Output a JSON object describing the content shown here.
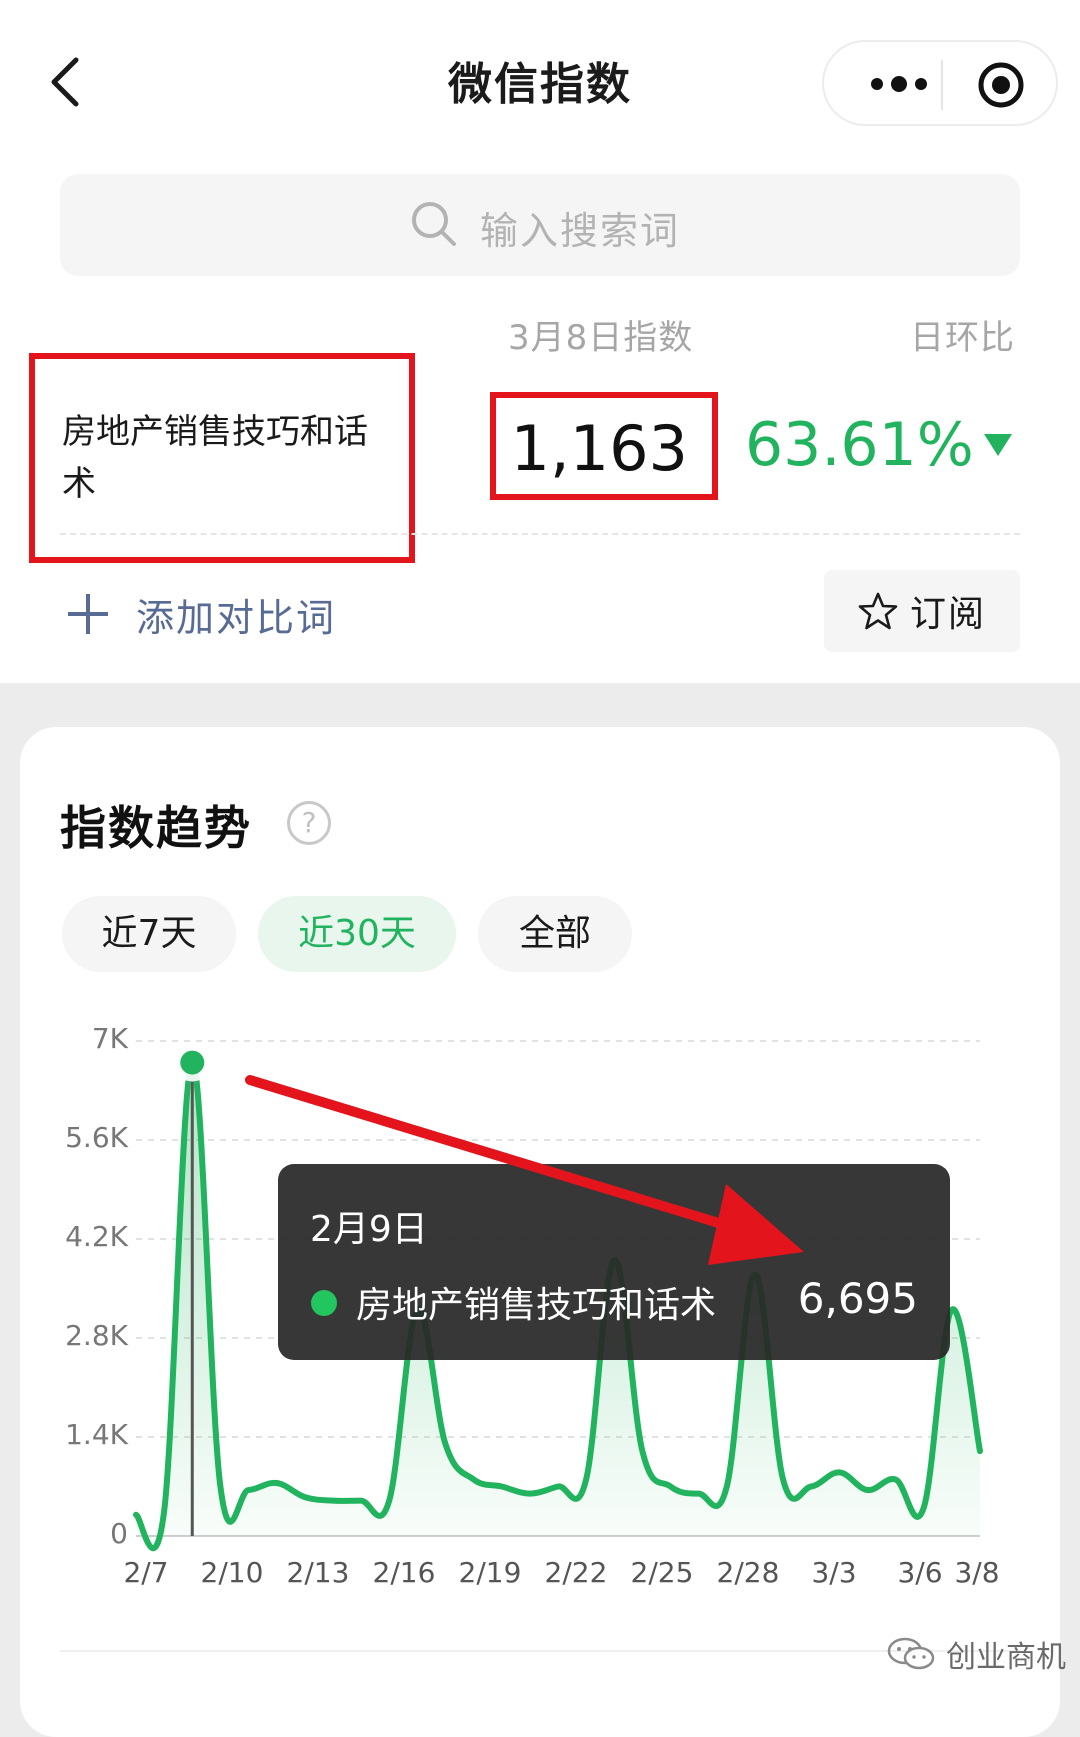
{
  "nav": {
    "title": "微信指数",
    "icons": [
      "back-chevron-icon",
      "more-dots-icon",
      "target-circle-icon"
    ]
  },
  "search": {
    "placeholder": "输入搜索词",
    "icon": "search-icon"
  },
  "index_header": {
    "date_label": "3月8日指数",
    "ratio_label": "日环比"
  },
  "keyword": {
    "text": "房地产销售技巧和话术",
    "value": "1,163",
    "ratio": "63.61%",
    "ratio_direction": "down",
    "ratio_color": "#22b35e"
  },
  "actions": {
    "add_compare": "添加对比词",
    "subscribe": "订阅"
  },
  "trend": {
    "title": "指数趋势",
    "help_icon": "?",
    "tabs": [
      {
        "label": "近7天",
        "active": false
      },
      {
        "label": "近30天",
        "active": true
      },
      {
        "label": "全部",
        "active": false
      }
    ]
  },
  "tooltip": {
    "date": "2月9日",
    "series": "房地产销售技巧和话术",
    "value": "6,695"
  },
  "watermark": {
    "text": "创业商机",
    "icon": "wechat-icon"
  },
  "chart_data": {
    "type": "area",
    "series": [
      {
        "name": "房地产销售技巧和话术",
        "color": "#22b35e",
        "values": [
          300,
          350,
          6695,
          700,
          650,
          750,
          550,
          500,
          500,
          500,
          3200,
          1300,
          800,
          700,
          600,
          700,
          800,
          3900,
          1200,
          700,
          600,
          700,
          3700,
          800,
          700,
          900,
          650,
          800,
          400,
          3200,
          1200
        ]
      }
    ],
    "x": [
      "2/7",
      "2/8",
      "2/9",
      "2/10",
      "2/11",
      "2/12",
      "2/13",
      "2/14",
      "2/15",
      "2/16",
      "2/17",
      "2/18",
      "2/19",
      "2/20",
      "2/21",
      "2/22",
      "2/23",
      "2/24",
      "2/25",
      "2/26",
      "2/27",
      "2/28",
      "3/1",
      "3/2",
      "3/3",
      "3/4",
      "3/5",
      "3/6",
      "3/7",
      "3/8"
    ],
    "x_ticks": [
      "2/7",
      "2/10",
      "2/13",
      "2/16",
      "2/19",
      "2/22",
      "2/25",
      "2/28",
      "3/3",
      "3/6",
      "3/8"
    ],
    "y_ticks": [
      "0",
      "1.4K",
      "2.8K",
      "4.2K",
      "5.6K",
      "7K"
    ],
    "ylim": [
      0,
      7000
    ],
    "highlight": {
      "x": "2/9",
      "value": 6695
    },
    "grid": "dashed-horizontal"
  }
}
